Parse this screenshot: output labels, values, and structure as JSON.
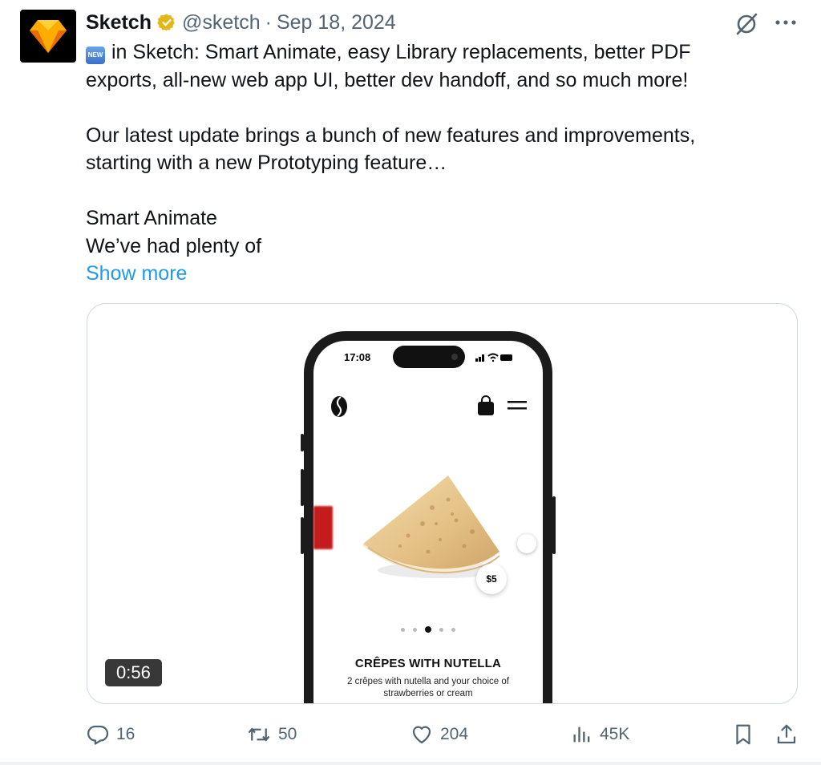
{
  "tweet": {
    "author_name": "Sketch",
    "author_handle": "@sketch",
    "separator": "·",
    "date": "Sep 18, 2024",
    "badge_text": "NEW",
    "lines": [
      "in Sketch: Smart Animate, easy Library replacements, better PDF",
      "exports, all-new web app UI, better dev handoff, and so much more!",
      "",
      "Our latest update brings a bunch of new features and improvements,",
      "starting with a new Prototyping feature…",
      "",
      "Smart Animate",
      "We’ve had plenty of"
    ],
    "show_more": "Show more"
  },
  "media": {
    "duration": "0:56",
    "phone": {
      "time": "17:08",
      "status_icons": "▂▄▆ ◠ ▬",
      "price": "$5",
      "product_title": "CRÊPES WITH NUTELLA",
      "product_description": "2 crêpes with nutella and your choice of strawberries or cream",
      "carousel_pages": 5,
      "carousel_active_index": 2
    }
  },
  "actions": {
    "replies": "16",
    "reposts": "50",
    "likes": "204",
    "views": "45K"
  },
  "colors": {
    "link": "#1d9bf0",
    "secondary_text": "#536471",
    "verified_gold": "#e2b719",
    "border": "#cfd9de"
  },
  "icons": [
    "sketch-logo-icon",
    "verified-badge-icon",
    "grok-icon",
    "more-icon",
    "reply-icon",
    "repost-icon",
    "like-icon",
    "views-icon",
    "bookmark-icon",
    "share-icon"
  ]
}
